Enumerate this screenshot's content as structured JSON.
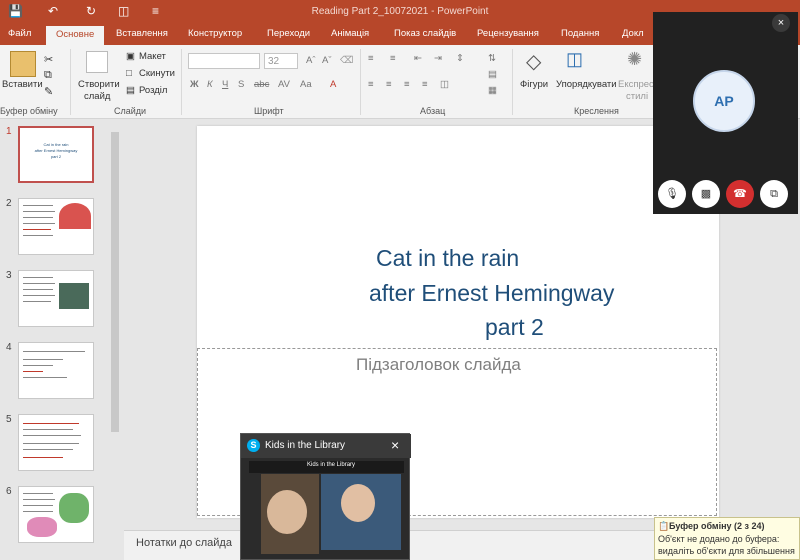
{
  "titlebar": {
    "title": "Reading Part 2_10072021 - PowerPoint"
  },
  "tabs": [
    "Файл",
    "Основне",
    "Вставлення",
    "Конструктор",
    "Переходи",
    "Анімація",
    "Показ слайдів",
    "Рецензування",
    "Подання",
    "Докл"
  ],
  "ribbon": {
    "paste": "Вставити",
    "new_slide_1": "Створити",
    "new_slide_2": "слайд",
    "layout": "Макет",
    "reset": "Скинути",
    "section": "Розділ",
    "font_size": "32",
    "figures": "Фігури",
    "arrange": "Упорядкувати",
    "express_1": "Експрес",
    "express_2": "стилі",
    "groups": {
      "clipboard": "Буфер обміну",
      "slides": "Слайди",
      "font": "Шрифт",
      "paragraph": "Абзац",
      "drawing": "Креслення"
    }
  },
  "thumbnails": {
    "numbers": [
      "1",
      "2",
      "3",
      "4",
      "5",
      "6"
    ],
    "slide1_lines": [
      "Cat in the rain",
      "after Ernest Hemingway",
      "part 2"
    ]
  },
  "slide": {
    "title_lines": [
      "Cat in the rain",
      "after Ernest Hemingway",
      "part 2"
    ],
    "subtitle_placeholder": "Підзаголовок слайда"
  },
  "notes": {
    "label": "Нотатки до слайда"
  },
  "call": {
    "initials": "AP"
  },
  "kids_window": {
    "title": "Kids in the Library",
    "inner_title": "Kids in the Library"
  },
  "clipboard_notice": {
    "title": "Буфер обміну (2 з 24)",
    "line1": "Об'єкт не додано до буфера:",
    "line2": "видаліть об'єкти для збільшення"
  }
}
